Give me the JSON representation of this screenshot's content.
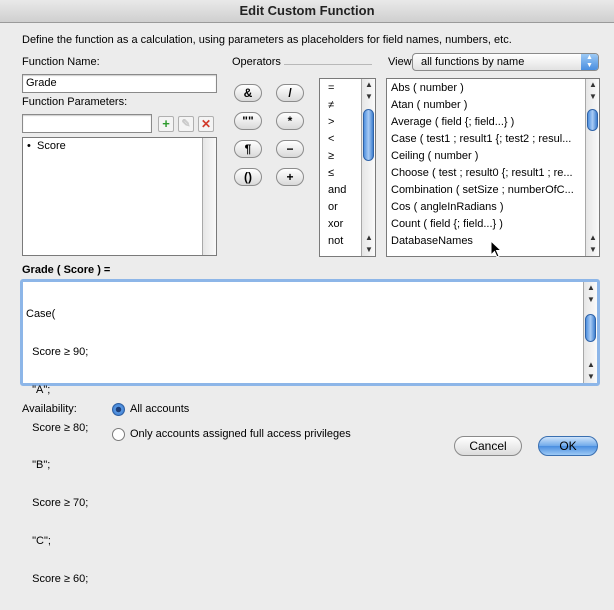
{
  "window": {
    "title": "Edit Custom Function"
  },
  "instructions": "Define the function as a calculation, using parameters as placeholders for field names, numbers, etc.",
  "function_name": {
    "label": "Function Name:",
    "value": "Grade"
  },
  "parameters": {
    "label": "Function Parameters:",
    "input_value": "",
    "items": [
      {
        "label": "Score"
      }
    ],
    "bullet": "•"
  },
  "operators": {
    "label": "Operators",
    "buttons": [
      "&",
      "/",
      "\"\"",
      "*",
      "¶",
      "−",
      "()",
      "+"
    ],
    "list": [
      "=",
      "≠",
      ">",
      "<",
      "≥",
      "≤",
      "and",
      "or",
      "xor",
      "not"
    ]
  },
  "view": {
    "label": "View",
    "selected": "all functions by name",
    "functions": [
      "Abs ( number )",
      "Atan ( number )",
      "Average ( field {; field...} )",
      "Case ( test1 ; result1 {; test2 ; resul...",
      "Ceiling ( number )",
      "Choose ( test ; result0 {; result1 ; re...",
      "Combination ( setSize ; numberOfC...",
      "Cos ( angleInRadians )",
      "Count ( field {; field...} )",
      "DatabaseNames"
    ]
  },
  "formula": {
    "label": "Grade ( Score ) =",
    "lines": [
      "Case(",
      "  Score ≥ 90;",
      "  \"A\";",
      "  Score ≥ 80;",
      "  \"B\";",
      "  Score ≥ 70;",
      "  \"C\";",
      "  Score ≥ 60;"
    ]
  },
  "availability": {
    "label": "Availability:",
    "options": [
      {
        "label": "All accounts",
        "selected": true
      },
      {
        "label": "Only accounts assigned full access privileges",
        "selected": false
      }
    ]
  },
  "buttons": {
    "cancel": "Cancel",
    "ok": "OK"
  },
  "colors": {
    "accent": "#4a8ee0",
    "add_green": "#2e9b2e",
    "remove_red": "#d23a2a"
  },
  "icons": {
    "add": "plus-icon",
    "edit": "pencil-icon",
    "remove": "x-icon"
  }
}
